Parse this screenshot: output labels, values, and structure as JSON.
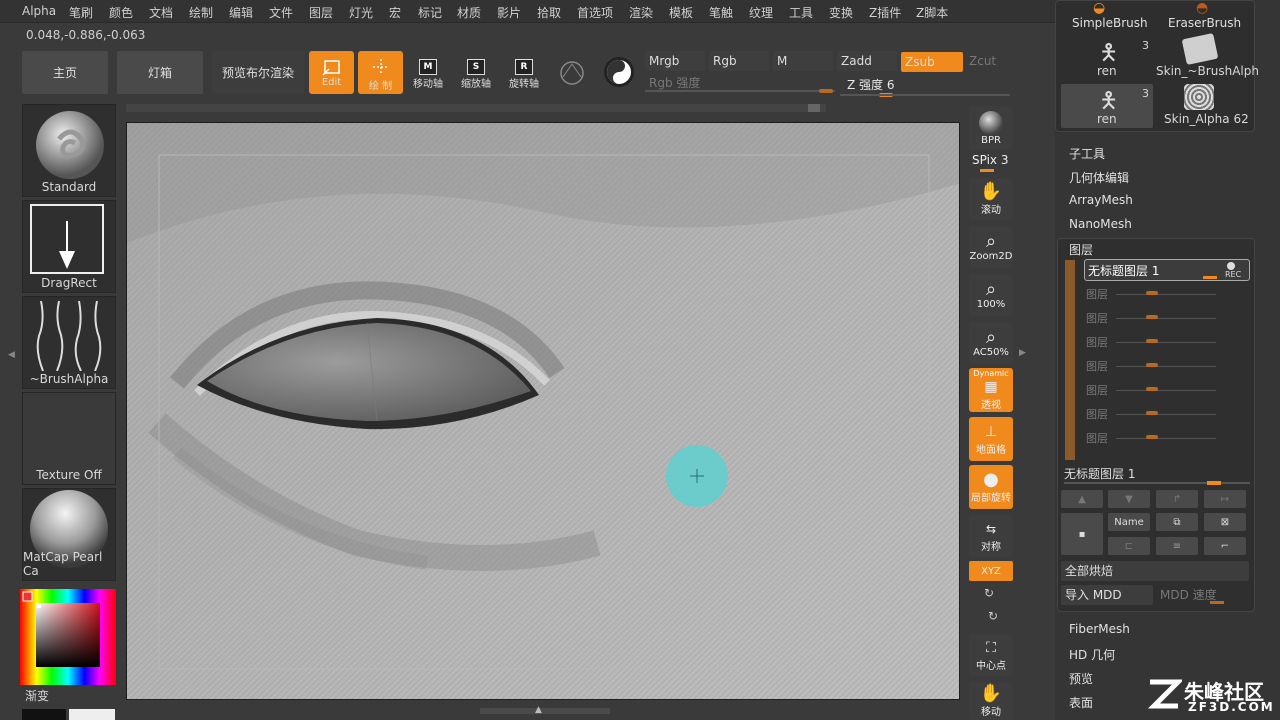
{
  "menu": [
    "Alpha",
    "笔刷",
    "颜色",
    "文档",
    "绘制",
    "编辑",
    "文件",
    "图层",
    "灯光",
    "宏",
    "标记",
    "材质",
    "影片",
    "拾取",
    "首选项",
    "渲染",
    "模板",
    "笔触",
    "纹理",
    "工具",
    "变换",
    "Z插件",
    "Z脚本"
  ],
  "coords": "0.048,-0.886,-0.063",
  "toolbar": {
    "home": "主页",
    "lightbox": "灯箱",
    "preview_bool": "预览布尔渲染",
    "edit": "Edit",
    "draw": "绘 制",
    "move": "移动轴",
    "scale": "缩放轴",
    "rotate": "旋转轴",
    "move_key": "M",
    "scale_key": "S",
    "rotate_key": "R"
  },
  "modes": {
    "mrgb": "Mrgb",
    "rgb": "Rgb",
    "m": "M",
    "zadd": "Zadd",
    "zsub": "Zsub",
    "zcut": "Zcut",
    "rgb_intensity": "Rgb 强度",
    "z_intensity": "Z 强度 6"
  },
  "left_shelf": {
    "brush": "Standard",
    "stroke": "DragRect",
    "alpha": "~BrushAlpha",
    "texture": "Texture Off",
    "material": "MatCap Pearl Ca",
    "gradient": "渐变"
  },
  "right_tools": {
    "bpr": "BPR",
    "spix": "SPix 3",
    "scroll": "滚动",
    "zoom2d": "Zoom2D",
    "zoom100": "100%",
    "ac50": "AC50%",
    "dynamic": "Dynamic",
    "persp": "透视",
    "floor": "地面格",
    "local": "局部旋转",
    "sym": "对称",
    "xyz": "XYZ",
    "center": "中心点",
    "move_bottom": "移动"
  },
  "right_panel": {
    "brush1": "SimpleBrush",
    "brush2": "EraserBrush",
    "tool1": "ren",
    "tool1_count": "3",
    "tool2": "Skin_~BrushAlph",
    "tool3": "ren",
    "tool3_count": "3",
    "tool4": "Skin_Alpha 62",
    "subtool": "子工具",
    "geometry": "几何体编辑",
    "arraymesh": "ArrayMesh",
    "nanomesh": "NanoMesh",
    "layers_title": "图层",
    "layer_active": "无标题图层 1",
    "rec": "REC",
    "layer_empty": "图层",
    "layer_current": "无标题图层 1",
    "name_btn": "Name",
    "bake_all": "全部烘焙",
    "import_mdd": "导入 MDD",
    "mdd_speed": "MDD 速度",
    "fibermesh": "FiberMesh",
    "hd_geometry": "HD 几何",
    "preview": "预览",
    "surface": "表面"
  },
  "watermark": {
    "brand": "朱峰社区",
    "url": "ZF3D.COM"
  },
  "colors": {
    "accent": "#f08a1c",
    "brush_cursor": "#5fd0d0",
    "bg": "#3a3a3a"
  }
}
